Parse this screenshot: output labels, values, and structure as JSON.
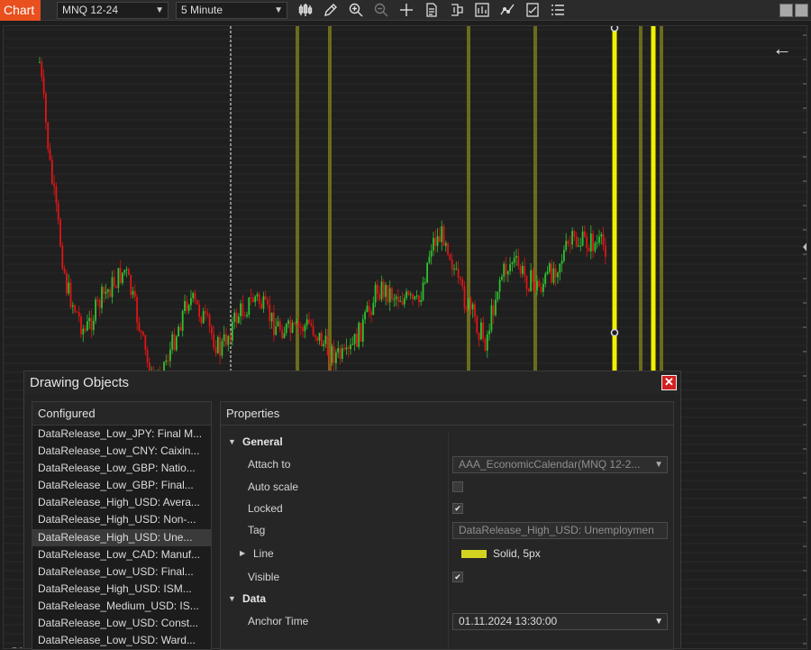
{
  "toolbar": {
    "tab_label": "Chart",
    "instrument": "MNQ 12-24",
    "interval": "5 Minute",
    "icons": [
      "bar-type-icon",
      "pencil-icon",
      "zoom-in-icon",
      "zoom-out-icon",
      "crosshair-icon",
      "data-box-icon",
      "indicators-icon",
      "strategies-icon",
      "drawing-tools-icon",
      "properties-icon",
      "list-icon"
    ]
  },
  "chart": {
    "copyright_symbol": "©",
    "copyright_fragment": "2",
    "colors": {
      "up": "#2fc22f",
      "down": "#e01515",
      "event_line": "#6b6b1c",
      "selected_line": "#f0f000"
    }
  },
  "dialog": {
    "title": "Drawing Objects",
    "close_symbol": "✕",
    "configured": {
      "header": "Configured",
      "items": [
        "DataRelease_Low_JPY: Final M...",
        "DataRelease_Low_CNY: Caixin...",
        "DataRelease_Low_GBP: Natio...",
        "DataRelease_Low_GBP: Final...",
        "DataRelease_High_USD: Avera...",
        "DataRelease_High_USD: Non-...",
        "DataRelease_High_USD: Une...",
        "DataRelease_Low_CAD: Manuf...",
        "DataRelease_Low_USD: Final...",
        "DataRelease_High_USD: ISM...",
        "DataRelease_Medium_USD: IS...",
        "DataRelease_Low_USD: Const...",
        "DataRelease_Low_USD: Ward..."
      ],
      "selected_index": 6
    },
    "properties": {
      "header": "Properties",
      "general_label": "General",
      "attach_to_label": "Attach to",
      "attach_to_value": "AAA_EconomicCalendar(MNQ 12-2...",
      "auto_scale_label": "Auto scale",
      "locked_label": "Locked",
      "tag_label": "Tag",
      "tag_value": "DataRelease_High_USD: Unemploymen",
      "line_label": "Line",
      "line_value": "Solid, 5px",
      "line_color": "#d4d420",
      "visible_label": "Visible",
      "data_label": "Data",
      "anchor_time_label": "Anchor Time",
      "anchor_time_value": "01.11.2024 13:30:00",
      "check_symbol": "✔"
    }
  }
}
